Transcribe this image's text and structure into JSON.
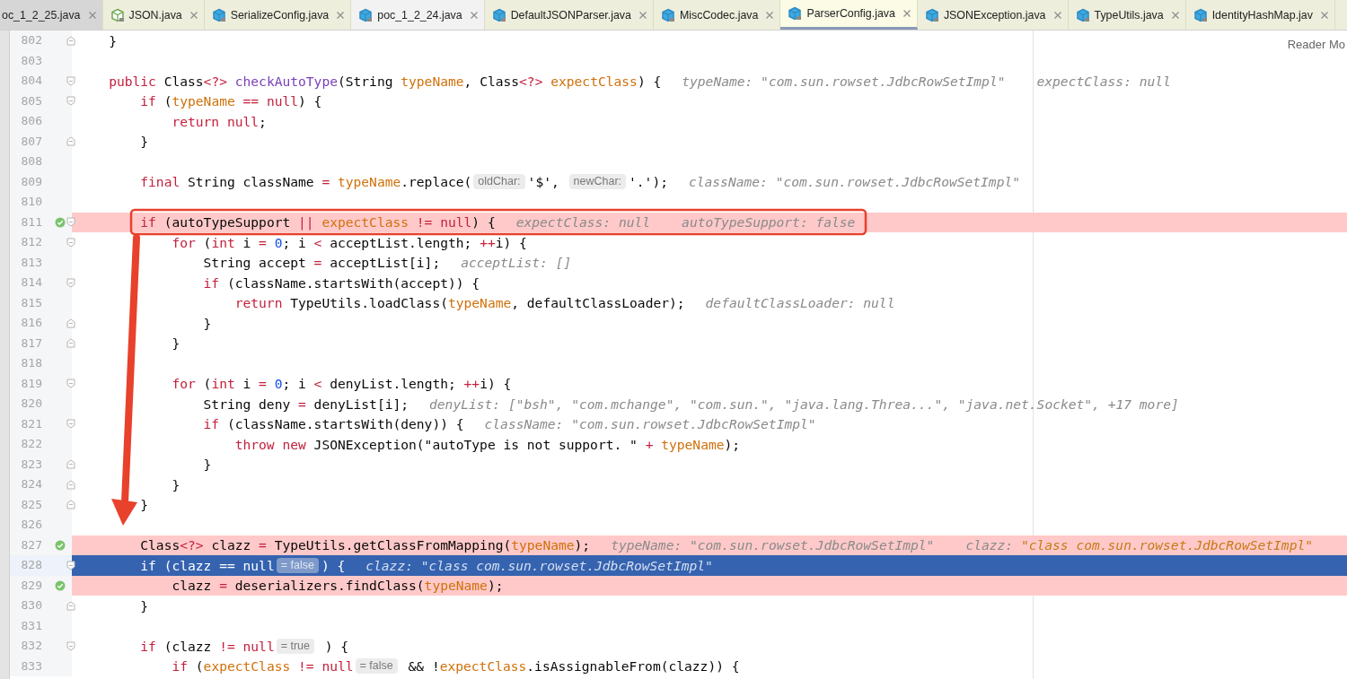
{
  "tabs": [
    {
      "label": "oc_1_2_25.java",
      "kind": "cut",
      "selected": false
    },
    {
      "label": "JSON.java",
      "kind": "interface",
      "selected": false
    },
    {
      "label": "SerializeConfig.java",
      "kind": "class",
      "selected": false
    },
    {
      "label": "poc_1_2_24.java",
      "kind": "project",
      "selected": false
    },
    {
      "label": "DefaultJSONParser.java",
      "kind": "class",
      "selected": false
    },
    {
      "label": "MiscCodec.java",
      "kind": "class",
      "selected": false
    },
    {
      "label": "ParserConfig.java",
      "kind": "class",
      "selected": true
    },
    {
      "label": "JSONException.java",
      "kind": "class",
      "selected": false
    },
    {
      "label": "TypeUtils.java",
      "kind": "class",
      "selected": false
    },
    {
      "label": "IdentityHashMap.jav",
      "kind": "class",
      "selected": false
    }
  ],
  "reader_mode": "Reader Mo",
  "lines": [
    {
      "number": "802",
      "fold_end": true,
      "tokens": [
        {
          "kind": "plain",
          "text": "    }"
        }
      ]
    },
    {
      "number": "803"
    },
    {
      "number": "804",
      "fold_start": true,
      "tokens": [
        {
          "kind": "keyword",
          "text": "    public"
        },
        {
          "kind": "plain",
          "text": " Class"
        },
        {
          "kind": "keyword",
          "text": "<?>"
        },
        {
          "kind": "method",
          "text": " checkAutoType"
        },
        {
          "kind": "plain",
          "text": "(String "
        },
        {
          "kind": "field",
          "text": "typeName"
        },
        {
          "kind": "plain",
          "text": ", Class"
        },
        {
          "kind": "keyword",
          "text": "<?>"
        },
        {
          "kind": "field",
          "text": " expectClass"
        },
        {
          "kind": "plain",
          "text": ") {"
        }
      ],
      "debug": [
        {
          "name": "typeName:",
          "value": "\"com.sun.rowset.JdbcRowSetImpl\"",
          "changed": false
        },
        {
          "name": "expectClass:",
          "value": "null",
          "changed": false
        }
      ]
    },
    {
      "number": "805",
      "fold_start": true,
      "tokens": [
        {
          "kind": "keyword",
          "text": "        if"
        },
        {
          "kind": "plain",
          "text": " ("
        },
        {
          "kind": "field",
          "text": "typeName"
        },
        {
          "kind": "keyword",
          "text": " == null"
        },
        {
          "kind": "plain",
          "text": ") {"
        }
      ]
    },
    {
      "number": "806",
      "tokens": [
        {
          "kind": "keyword",
          "text": "            return null"
        },
        {
          "kind": "plain",
          "text": ";"
        }
      ]
    },
    {
      "number": "807",
      "fold_end": true,
      "tokens": [
        {
          "kind": "plain",
          "text": "        }"
        }
      ]
    },
    {
      "number": "808"
    },
    {
      "number": "809",
      "tokens": [
        {
          "kind": "keyword",
          "text": "        final"
        },
        {
          "kind": "plain",
          "text": " String className"
        },
        {
          "kind": "keyword",
          "text": " ="
        },
        {
          "kind": "field",
          "text": " typeName"
        },
        {
          "kind": "plain",
          "text": ".replace("
        },
        {
          "kind": "hint",
          "text": "oldChar:"
        },
        {
          "kind": "plain",
          "text": "'$', "
        },
        {
          "kind": "hint",
          "text": "newChar:"
        },
        {
          "kind": "plain",
          "text": "'.');"
        }
      ],
      "debug": [
        {
          "name": "className:",
          "value": "\"com.sun.rowset.JdbcRowSetImpl\"",
          "changed": false
        }
      ]
    },
    {
      "number": "810"
    },
    {
      "number": "811",
      "breakpoint": true,
      "fold_start": true,
      "tokens": [
        {
          "kind": "keyword",
          "text": "        if"
        },
        {
          "kind": "plain",
          "text": " (autoTypeSupport"
        },
        {
          "kind": "keyword",
          "text": " ||"
        },
        {
          "kind": "field",
          "text": " expectClass"
        },
        {
          "kind": "keyword",
          "text": " != null"
        },
        {
          "kind": "plain",
          "text": ") {"
        }
      ],
      "debug": [
        {
          "name": "expectClass:",
          "value": "null",
          "changed": false
        },
        {
          "name": "autoTypeSupport:",
          "value": "false",
          "changed": false
        }
      ]
    },
    {
      "number": "812",
      "fold_start": true,
      "tokens": [
        {
          "kind": "keyword",
          "text": "            for"
        },
        {
          "kind": "plain",
          "text": " ("
        },
        {
          "kind": "keyword",
          "text": "int"
        },
        {
          "kind": "plain",
          "text": " i"
        },
        {
          "kind": "keyword",
          "text": " ="
        },
        {
          "kind": "number",
          "text": " 0"
        },
        {
          "kind": "plain",
          "text": "; i"
        },
        {
          "kind": "keyword",
          "text": " <"
        },
        {
          "kind": "plain",
          "text": " acceptList.length;"
        },
        {
          "kind": "keyword",
          "text": " ++"
        },
        {
          "kind": "plain",
          "text": "i) {"
        }
      ]
    },
    {
      "number": "813",
      "tokens": [
        {
          "kind": "plain",
          "text": "                String accept"
        },
        {
          "kind": "keyword",
          "text": " ="
        },
        {
          "kind": "plain",
          "text": " acceptList[i];"
        }
      ],
      "debug": [
        {
          "name": "acceptList:",
          "value": "[]",
          "changed": false
        }
      ]
    },
    {
      "number": "814",
      "fold_start": true,
      "tokens": [
        {
          "kind": "keyword",
          "text": "                if"
        },
        {
          "kind": "plain",
          "text": " (className.startsWith(accept)) {"
        }
      ]
    },
    {
      "number": "815",
      "tokens": [
        {
          "kind": "keyword",
          "text": "                    return"
        },
        {
          "kind": "plain",
          "text": " TypeUtils.loadClass("
        },
        {
          "kind": "field",
          "text": "typeName"
        },
        {
          "kind": "plain",
          "text": ", defaultClassLoader);"
        }
      ],
      "debug": [
        {
          "name": "defaultClassLoader:",
          "value": "null",
          "changed": false
        }
      ]
    },
    {
      "number": "816",
      "fold_end": true,
      "tokens": [
        {
          "kind": "plain",
          "text": "                }"
        }
      ]
    },
    {
      "number": "817",
      "fold_end": true,
      "tokens": [
        {
          "kind": "plain",
          "text": "            }"
        }
      ]
    },
    {
      "number": "818"
    },
    {
      "number": "819",
      "fold_start": true,
      "tokens": [
        {
          "kind": "keyword",
          "text": "            for"
        },
        {
          "kind": "plain",
          "text": " ("
        },
        {
          "kind": "keyword",
          "text": "int"
        },
        {
          "kind": "plain",
          "text": " i"
        },
        {
          "kind": "keyword",
          "text": " ="
        },
        {
          "kind": "number",
          "text": " 0"
        },
        {
          "kind": "plain",
          "text": "; i"
        },
        {
          "kind": "keyword",
          "text": " <"
        },
        {
          "kind": "plain",
          "text": " denyList.length;"
        },
        {
          "kind": "keyword",
          "text": " ++"
        },
        {
          "kind": "plain",
          "text": "i) {"
        }
      ]
    },
    {
      "number": "820",
      "tokens": [
        {
          "kind": "plain",
          "text": "                String deny"
        },
        {
          "kind": "keyword",
          "text": " ="
        },
        {
          "kind": "plain",
          "text": " denyList[i];"
        }
      ],
      "debug": [
        {
          "name": "denyList:",
          "value": "[\"bsh\", \"com.mchange\", \"com.sun.\", \"java.lang.Threa...\", \"java.net.Socket\", +17 more]",
          "changed": false
        }
      ]
    },
    {
      "number": "821",
      "fold_start": true,
      "tokens": [
        {
          "kind": "keyword",
          "text": "                if"
        },
        {
          "kind": "plain",
          "text": " (className.startsWith(deny)) {"
        }
      ],
      "debug": [
        {
          "name": "className:",
          "value": "\"com.sun.rowset.JdbcRowSetImpl\"",
          "changed": false
        }
      ]
    },
    {
      "number": "822",
      "tokens": [
        {
          "kind": "keyword",
          "text": "                    throw new"
        },
        {
          "kind": "plain",
          "text": " JSONException(\"autoType is not support. \""
        },
        {
          "kind": "keyword",
          "text": " +"
        },
        {
          "kind": "field",
          "text": " typeName"
        },
        {
          "kind": "plain",
          "text": ");"
        }
      ]
    },
    {
      "number": "823",
      "fold_end": true,
      "tokens": [
        {
          "kind": "plain",
          "text": "                }"
        }
      ]
    },
    {
      "number": "824",
      "fold_end": true,
      "tokens": [
        {
          "kind": "plain",
          "text": "            }"
        }
      ]
    },
    {
      "number": "825",
      "fold_end": true,
      "tokens": [
        {
          "kind": "plain",
          "text": "        }"
        }
      ]
    },
    {
      "number": "826"
    },
    {
      "number": "827",
      "breakpoint": true,
      "tokens": [
        {
          "kind": "plain",
          "text": "        Class"
        },
        {
          "kind": "keyword",
          "text": "<?>"
        },
        {
          "kind": "plain",
          "text": " clazz"
        },
        {
          "kind": "keyword",
          "text": " ="
        },
        {
          "kind": "plain",
          "text": " TypeUtils.getClassFromMapping("
        },
        {
          "kind": "field",
          "text": "typeName"
        },
        {
          "kind": "plain",
          "text": ");"
        }
      ],
      "debug": [
        {
          "name": "typeName:",
          "value": "\"com.sun.rowset.JdbcRowSetImpl\"",
          "changed": false
        },
        {
          "name": "clazz:",
          "value": "\"class com.sun.rowset.JdbcRowSetImpl\"",
          "changed": true
        }
      ]
    },
    {
      "number": "828",
      "current": true,
      "fold_start": true,
      "tokens": [
        {
          "kind": "keyword",
          "text": "        if"
        },
        {
          "kind": "plain",
          "text": " (clazz"
        },
        {
          "kind": "keyword",
          "text": " == null"
        },
        {
          "kind": "hint",
          "text": "= false"
        },
        {
          "kind": "plain",
          "text": ") {"
        }
      ],
      "debug": [
        {
          "name": "clazz:",
          "value": "\"class com.sun.rowset.JdbcRowSetImpl\"",
          "changed": false
        }
      ]
    },
    {
      "number": "829",
      "breakpoint": true,
      "tokens": [
        {
          "kind": "plain",
          "text": "            clazz"
        },
        {
          "kind": "keyword",
          "text": " ="
        },
        {
          "kind": "plain",
          "text": " deserializers.findClass("
        },
        {
          "kind": "field",
          "text": "typeName"
        },
        {
          "kind": "plain",
          "text": ");"
        }
      ]
    },
    {
      "number": "830",
      "fold_end": true,
      "tokens": [
        {
          "kind": "plain",
          "text": "        }"
        }
      ]
    },
    {
      "number": "831"
    },
    {
      "number": "832",
      "fold_start": true,
      "tokens": [
        {
          "kind": "keyword",
          "text": "        if"
        },
        {
          "kind": "plain",
          "text": " (clazz"
        },
        {
          "kind": "keyword",
          "text": " != null"
        },
        {
          "kind": "hint",
          "text": "= true"
        },
        {
          "kind": "plain",
          "text": " ) {"
        }
      ]
    },
    {
      "number": "833",
      "tokens": [
        {
          "kind": "keyword",
          "text": "            if"
        },
        {
          "kind": "plain",
          "text": " ("
        },
        {
          "kind": "field",
          "text": "expectClass"
        },
        {
          "kind": "keyword",
          "text": " != null"
        },
        {
          "kind": "hint",
          "text": "= false"
        },
        {
          "kind": "plain",
          "text": " && !"
        },
        {
          "kind": "field",
          "text": "expectClass"
        },
        {
          "kind": "plain",
          "text": ".isAssignableFrom(clazz)) {"
        }
      ]
    }
  ]
}
